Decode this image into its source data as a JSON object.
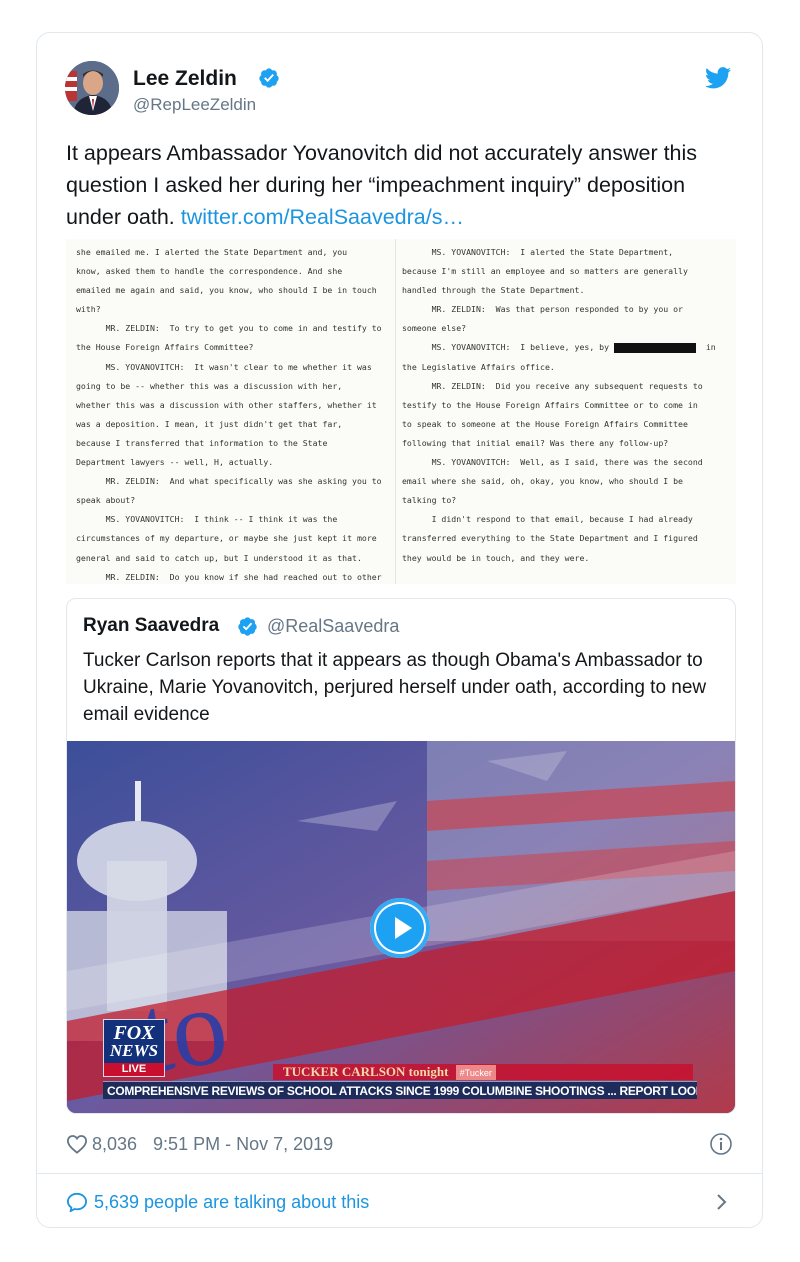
{
  "tweet": {
    "author_name": "Lee Zeldin",
    "author_handle": "@RepLeeZeldin",
    "text": "It appears Ambassador Yovanovitch did not accurately answer this question I asked her during her “impeachment inquiry” deposition under oath.",
    "link": "twitter.com/RealSaavedra/s…",
    "likes": "8,036",
    "timestamp": "9:51 PM - Nov 7, 2019",
    "talking": "5,639 people are talking about this",
    "icons": [
      "verified-badge-icon",
      "twitter-bird-icon",
      "heart-icon",
      "info-icon",
      "comment-bubble-icon",
      "chevron-right-icon",
      "play-icon"
    ],
    "colors": {
      "link": "#1b95e0",
      "muted": "#657786",
      "text": "#14171a",
      "border": "#e1e8ed"
    }
  },
  "document": {
    "left_lines": [
      "she emailed me. I alerted the State Department and, you",
      "know, asked them to handle the correspondence.  And she",
      "emailed me again and said, you know, who should I be in touch",
      "with?",
      "      MR. ZELDIN:  To try to get you to come in and testify to",
      "the House Foreign Affairs Committee?",
      "      MS. YOVANOVITCH:  It wasn't clear to me whether it was",
      "going to be -- whether this was a discussion with her,",
      "whether this was a discussion with other staffers, whether it",
      "was a deposition.  I mean, it just didn't get that far,",
      "because I transferred that information to the State",
      "Department lawyers -- well, H, actually.",
      "      MR. ZELDIN:  And what specifically was she asking you to",
      "speak about?",
      "      MS. YOVANOVITCH:  I think -- I think it was the",
      "circumstances of my departure, or maybe she just kept it more",
      "general and said to catch up, but I understood it as that.",
      "      MR. ZELDIN:  Do you know if she had reached out to other"
    ],
    "right_lines": [
      "      MS. YOVANOVITCH:  I alerted the State Department,",
      "because I'm still an employee and so matters are generally",
      "handled through the State Department.",
      "      MR. ZELDIN:  Was that person responded to by you or",
      "someone else?",
      "      MS. YOVANOVITCH:  I believe, yes, by",
      "the Legislative Affairs office.",
      "      MR. ZELDIN:  Did you receive any subsequent requests to",
      "testify to the House Foreign Affairs Committee or to come in",
      "to speak to someone at the House Foreign Affairs Committee",
      "following that initial email?  Was there any follow-up?",
      "      MS. YOVANOVITCH:  Well, as I said, there was the second",
      "email where she said, oh, okay, you know, who should I be",
      "talking to?",
      "      I didn't respond to that email, because I had already",
      "transferred everything to the State Department and I figured",
      "they would be in touch, and they were."
    ],
    "redaction_suffix": "in"
  },
  "quoted": {
    "author_name": "Ryan Saavedra",
    "author_handle": "@RealSaavedra",
    "text": "Tucker Carlson reports that it appears as though Obama's Ambassador to Ukraine, Marie Yovanovitch, perjured herself under oath, according to new email evidence"
  },
  "video": {
    "logo_line1": "FOX",
    "logo_line2": "NEWS",
    "logo_line3": "LIVE",
    "show_title": "TUCKER CARLSON tonight",
    "show_tag": "#Tucker",
    "ticker": "COMPREHENSIVE REVIEWS OF SCHOOL ATTACKS SINCE 1999 COLUMBINE SHOOTINGS ...  REPORT LOOK",
    "overlay_text": "to"
  }
}
